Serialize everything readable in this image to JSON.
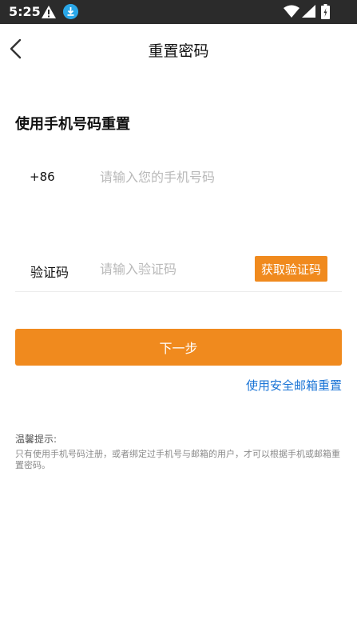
{
  "status_bar": {
    "time": "5:25",
    "icons": [
      "alert-icon",
      "download-icon",
      "wifi-icon",
      "signal-icon",
      "battery-icon"
    ],
    "download_color": "#2aa7e8"
  },
  "header": {
    "title": "重置密码",
    "back_icon": "chevron-left-icon"
  },
  "form": {
    "section_title": "使用手机号码重置",
    "phone": {
      "country_code": "+86",
      "placeholder": "请输入您的手机号码",
      "value": ""
    },
    "code": {
      "label": "验证码",
      "placeholder": "请输入验证码",
      "value": "",
      "get_code_label": "获取验证码"
    },
    "next_label": "下一步",
    "email_reset_label": "使用安全邮箱重置"
  },
  "tips": {
    "title": "温馨提示:",
    "text": "只有使用手机号码注册，或者绑定过手机号与邮箱的用户，才可以根据手机或邮箱重置密码。"
  },
  "colors": {
    "accent": "#f08a1e",
    "link": "#1a74d6",
    "status_bar": "#2b2b2b"
  }
}
